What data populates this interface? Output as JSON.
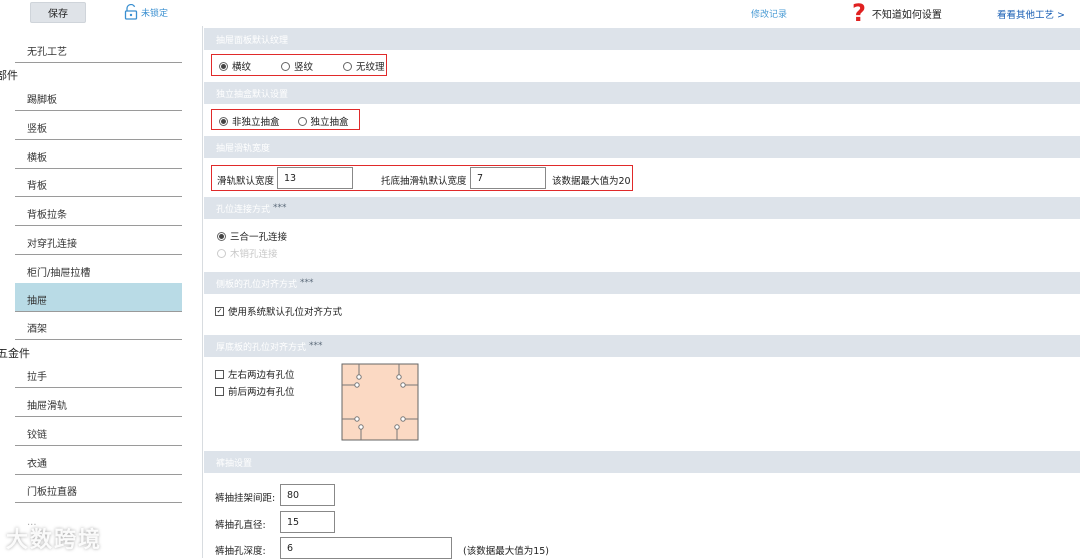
{
  "toolbar": {
    "save_label": "保存",
    "lock_label": "未锁定",
    "changelog_label": "修改记录",
    "help_label": "不知道如何设置",
    "other_label": "看看其他工艺 >"
  },
  "sidebar": {
    "items": [
      {
        "label": "无孔工艺"
      },
      {
        "label": "踢脚板"
      },
      {
        "label": "竖板"
      },
      {
        "label": "横板"
      },
      {
        "label": "背板"
      },
      {
        "label": "背板拉条"
      },
      {
        "label": "对穿孔连接"
      },
      {
        "label": "柜门/抽屉拉槽"
      },
      {
        "label": "抽屉"
      },
      {
        "label": "酒架"
      },
      {
        "label": "拉手"
      },
      {
        "label": "抽屉滑轨"
      },
      {
        "label": "铰链"
      },
      {
        "label": "衣通"
      },
      {
        "label": "门板拉直器"
      },
      {
        "label": "..."
      }
    ],
    "groups": [
      "部件",
      "五金件"
    ],
    "active_index": 8
  },
  "sections": {
    "texture": {
      "title": "抽屉面板默认纹理",
      "options": [
        "横纹",
        "竖纹",
        "无纹理"
      ],
      "selected": "横纹"
    },
    "box": {
      "title": "独立抽盒默认设置",
      "options": [
        "非独立抽盒",
        "独立抽盒"
      ],
      "selected": "非独立抽盒"
    },
    "rail": {
      "title": "抽屉滑轨宽度",
      "rail_width_label": "滑轨默认宽度",
      "rail_width_value": "13",
      "bottom_rail_label": "托底抽滑轨默认宽度",
      "bottom_rail_value": "7",
      "max_note": "该数据最大值为20"
    },
    "hole_conn": {
      "title": "孔位连接方式",
      "stars": "***",
      "options": [
        "三合一孔连接",
        "木销孔连接"
      ],
      "selected": "三合一孔连接"
    },
    "side_align": {
      "title": "侧板的孔位对齐方式",
      "stars": "***",
      "checkbox_label": "使用系统默认孔位对齐方式",
      "checked": true
    },
    "bottom_align": {
      "title": "厚底板的孔位对齐方式",
      "stars": "***",
      "opt1": "左右两边有孔位",
      "opt2": "前后两边有孔位"
    },
    "pants": {
      "title": "裤抽设置",
      "spacing_label": "裤抽挂架间距:",
      "spacing_value": "80",
      "diameter_label": "裤抽孔直径:",
      "diameter_value": "15",
      "depth_label": "裤抽孔深度:",
      "depth_value": "6",
      "depth_note": "(该数据最大值为15)"
    }
  },
  "colors": {
    "accent": "#3a8fd0",
    "highlight_box": "#e02a2a",
    "section_head": "#dde3ea",
    "active_item": "#b9dbe6",
    "diagram_fill": "#fbd9c3"
  },
  "watermark": "大数跨境"
}
